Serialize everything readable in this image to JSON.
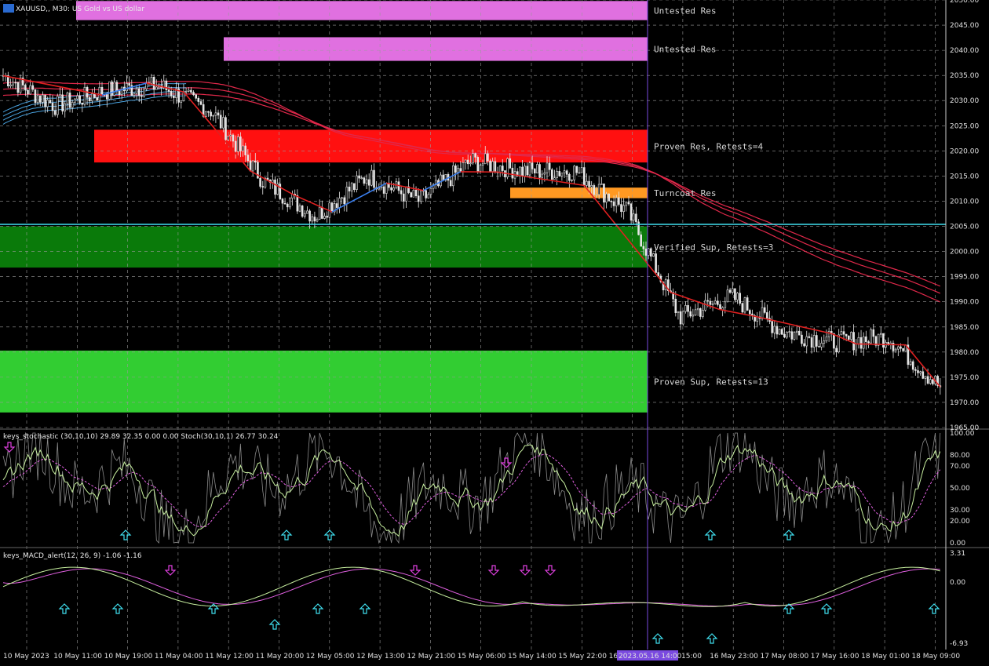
{
  "window": {
    "symbol_title": "XAUUSD,, M30: US Gold vs US dollar"
  },
  "colors": {
    "background": "#000000",
    "grid": "#9a9a9a",
    "candle": "#e6e6e6",
    "ema_red": "#e0284a",
    "ema_blue": "#4aa3e0",
    "zigzag_up": "#3a7ff0",
    "zigzag_down": "#e02020",
    "untested_res": "#e070e0",
    "proven_res": "#ff1010",
    "turncoat_res": "#ff9922",
    "verified_sup": "#0a7a0a",
    "proven_sup": "#32cd32",
    "stoch_main": "#c8f0a0",
    "stoch_signal": "#e060e0",
    "macd_main": "#c8f0a0",
    "macd_signal": "#e060e0",
    "arrow_up": "#40e0f0",
    "arrow_down": "#e040e0",
    "vline": "#7a4ae0"
  },
  "zones": [
    {
      "label": "Untested Res",
      "top": 2049.8,
      "bottom": 2046.0,
      "color": "untested_res"
    },
    {
      "label": "Untested Res",
      "top": 2042.6,
      "bottom": 2037.9,
      "color": "untested_res"
    },
    {
      "label": "Proven Res, Retests=4",
      "top": 2024.2,
      "bottom": 2017.7,
      "color": "proven_res"
    },
    {
      "label": "Turncoat Res",
      "top": 2012.7,
      "bottom": 2010.6,
      "color": "turncoat_res"
    },
    {
      "label": "Verified Sup, Retests=3",
      "top": 2005.0,
      "bottom": 1996.8,
      "color": "verified_sup"
    },
    {
      "label": "Proven Sup, Retests=13",
      "top": 1980.3,
      "bottom": 1968.0,
      "color": "proven_sup"
    }
  ],
  "price_axis": {
    "ticks": [
      "2050.00",
      "2045.00",
      "2040.00",
      "2035.00",
      "2030.00",
      "2025.00",
      "2020.00",
      "2015.00",
      "2010.00",
      "2005.00",
      "2000.00",
      "1995.00",
      "1990.00",
      "1985.00",
      "1980.00",
      "1975.00",
      "1970.00",
      "1965.00"
    ],
    "current_price_line": 2005.4
  },
  "time_axis": {
    "labels": [
      "10 May 2023",
      "10 May 11:00",
      "10 May 19:00",
      "11 May 04:00",
      "11 May 12:00",
      "11 May 20:00",
      "12 May 05:00",
      "12 May 13:00",
      "12 May 21:00",
      "15 May 06:00",
      "15 May 14:00",
      "15 May 22:00",
      "16 M",
      "15:00",
      "16 May 23:00",
      "17 May 08:00",
      "17 May 16:00",
      "18 May 01:00",
      "18 May 09:00"
    ],
    "cursor_label": "2023.05.16 14:00"
  },
  "stochastic": {
    "title": "keys_stochastic (30,10,10) 29.89 32.35 0.00 0.00 Stoch(30,10,1) 26.77 30.24",
    "ticks": [
      "100.00",
      "80.00",
      "70.00",
      "50.00",
      "30.00",
      "20.00",
      "0.00"
    ]
  },
  "macd": {
    "title": "keys_MACD_alert(12, 26, 9) -1.06 -1.16",
    "ticks": [
      "3.31",
      "0.00",
      "-6.93"
    ]
  },
  "chart_data": {
    "type": "candlestick",
    "title": "XAUUSD,, M30: US Gold vs US dollar",
    "ylim": [
      1965,
      2050
    ],
    "x": [
      "10 May 2023",
      "10 May 11:00",
      "10 May 19:00",
      "11 May 04:00",
      "11 May 12:00",
      "11 May 20:00",
      "12 May 05:00",
      "12 May 13:00",
      "12 May 21:00",
      "15 May 06:00",
      "15 May 14:00",
      "15 May 22:00",
      "16 May 06:00",
      "16 May 15:00",
      "16 May 23:00",
      "17 May 08:00",
      "17 May 16:00",
      "18 May 01:00",
      "18 May 09:00"
    ],
    "close_approx": [
      2035,
      2029,
      2032,
      2033,
      2028,
      2014,
      2007,
      2015,
      2010,
      2018,
      2016,
      2016,
      2008,
      1987,
      1991,
      1984,
      1982,
      1983,
      1973
    ],
    "stoch_ylim": [
      0,
      100
    ],
    "macd_ylim": [
      -6.93,
      3.31
    ]
  }
}
